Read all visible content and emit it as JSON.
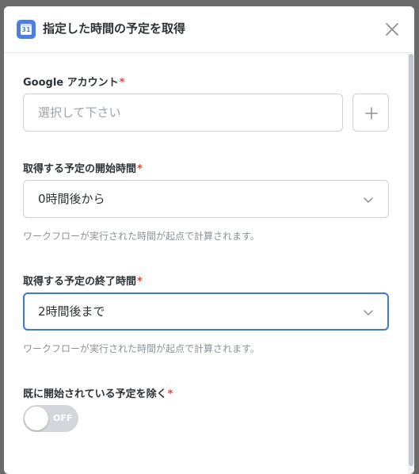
{
  "dialog": {
    "title": "指定した時間の予定を取得",
    "calendar_icon_text": "31"
  },
  "fields": {
    "google_account": {
      "label": "Google アカウント",
      "required_mark": "*",
      "placeholder": "選択して下さい"
    },
    "start_time": {
      "label": "取得する予定の開始時間",
      "required_mark": "*",
      "value": "0時間後から",
      "helper": "ワークフローが実行された時間が起点で計算されます。"
    },
    "end_time": {
      "label": "取得する予定の終了時間",
      "required_mark": "*",
      "value": "2時間後まで",
      "helper": "ワークフローが実行された時間が起点で計算されます。"
    },
    "exclude_started": {
      "label": "既に開始されている予定を除く",
      "required_mark": "*",
      "toggle_text": "OFF",
      "enabled": false
    }
  },
  "colors": {
    "accent": "#3f76d9",
    "required": "#e0443a",
    "toggle_off": "#d3d6da"
  },
  "icons": [
    "calendar-icon",
    "close-icon",
    "plus-icon",
    "chevron-down-icon"
  ]
}
